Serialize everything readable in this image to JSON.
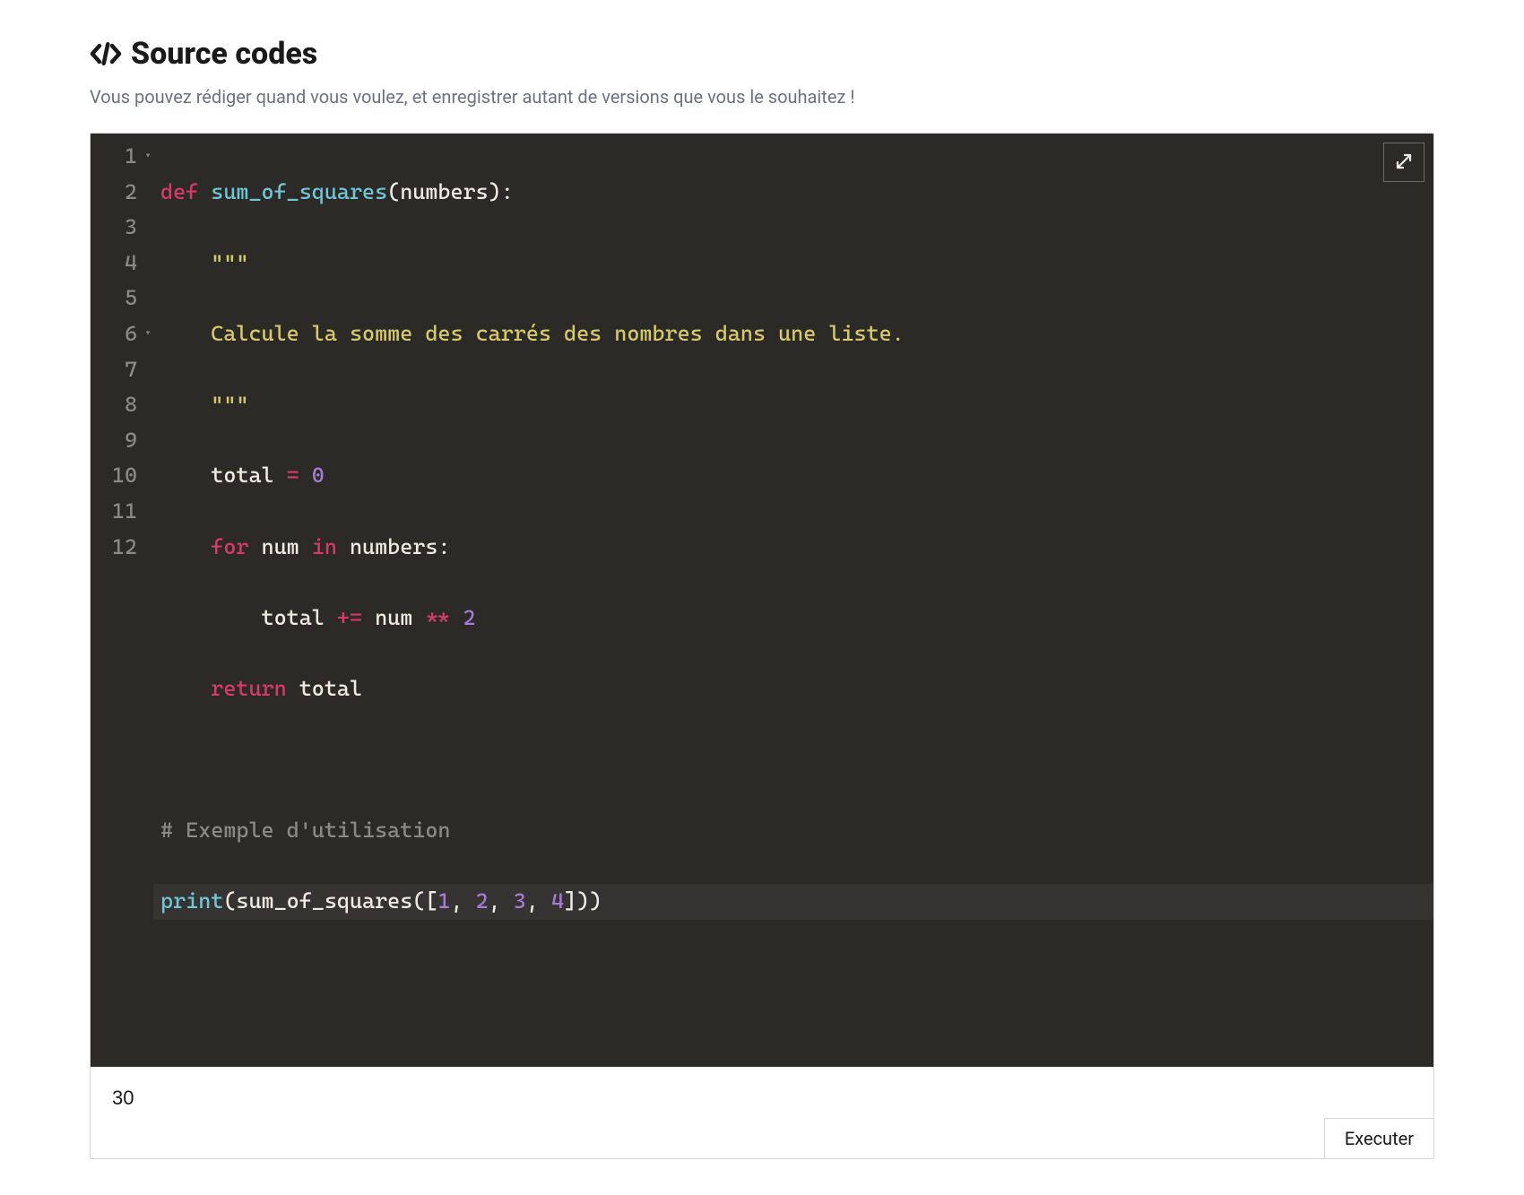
{
  "header": {
    "title": "Source codes",
    "subtitle": "Vous pouvez rédiger quand vous voulez, et enregistrer autant de versions que vous le souhaitez !"
  },
  "editor": {
    "line_numbers": [
      "1",
      "2",
      "3",
      "4",
      "5",
      "6",
      "7",
      "8",
      "9",
      "10",
      "11",
      "12"
    ],
    "fold_lines": [
      1,
      6
    ],
    "active_line": 11,
    "code": {
      "l1_def": "def",
      "l1_fn": "sum_of_squares",
      "l1_rest": "(numbers):",
      "l2": "    \"\"\"",
      "l3": "    Calcule la somme des carrés des nombres dans une liste.",
      "l4": "    \"\"\"",
      "l5_a": "    total ",
      "l5_op": "=",
      "l5_sp": " ",
      "l5_num": "0",
      "l6_for": "    for",
      "l6_mid": " num ",
      "l6_in": "in",
      "l6_rest": " numbers:",
      "l7_a": "        total ",
      "l7_op1": "+=",
      "l7_b": " num ",
      "l7_op2": "**",
      "l7_sp": " ",
      "l7_num": "2",
      "l8_ret": "    return",
      "l8_rest": " total",
      "l9": "",
      "l10": "# Exemple d'utilisation",
      "l11_fn": "print",
      "l11_a": "(sum_of_squares([",
      "l11_n1": "1",
      "l11_c1": ", ",
      "l11_n2": "2",
      "l11_c2": ", ",
      "l11_n3": "3",
      "l11_c3": ", ",
      "l11_n4": "4",
      "l11_b": "]))",
      "l12": ""
    }
  },
  "output": {
    "value": "30"
  },
  "buttons": {
    "execute": "Executer"
  }
}
